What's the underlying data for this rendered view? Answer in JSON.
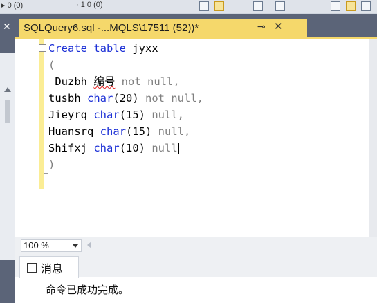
{
  "toolbar": {
    "fragment_left": "▸ 0 (0) ",
    "fragment_mid": "· 1 0 (0)"
  },
  "tab": {
    "title": "SQLQuery6.sql -...MQLS\\17511 (52))*",
    "pin_glyph": "⊸",
    "close_glyph": "✕"
  },
  "editor": {
    "lines": [
      {
        "parts": [
          {
            "t": "Create table ",
            "c": "kw"
          },
          {
            "t": "jyxx",
            "c": ""
          }
        ]
      },
      {
        "parts": [
          {
            "t": "(",
            "c": "gray"
          }
        ]
      },
      {
        "parts": [
          {
            "t": " Duzbh ",
            "c": ""
          },
          {
            "t": "编号",
            "c": "squiggle"
          },
          {
            "t": " not null,",
            "c": "gray"
          }
        ]
      },
      {
        "parts": [
          {
            "t": "tusbh ",
            "c": ""
          },
          {
            "t": "char",
            "c": "kw"
          },
          {
            "t": "(20) ",
            "c": ""
          },
          {
            "t": "not null,",
            "c": "gray"
          }
        ]
      },
      {
        "parts": [
          {
            "t": "Jieyrq ",
            "c": ""
          },
          {
            "t": "char",
            "c": "kw"
          },
          {
            "t": "(15) ",
            "c": ""
          },
          {
            "t": "null,",
            "c": "gray"
          }
        ]
      },
      {
        "parts": [
          {
            "t": "Huansrq ",
            "c": ""
          },
          {
            "t": "char",
            "c": "kw"
          },
          {
            "t": "(15) ",
            "c": ""
          },
          {
            "t": "null,",
            "c": "gray"
          }
        ]
      },
      {
        "parts": [
          {
            "t": "Shifxj ",
            "c": ""
          },
          {
            "t": "char",
            "c": "kw"
          },
          {
            "t": "(10) ",
            "c": ""
          },
          {
            "t": "null",
            "c": "gray"
          }
        ],
        "caret": true
      },
      {
        "parts": [
          {
            "t": ")",
            "c": "gray"
          }
        ]
      }
    ]
  },
  "zoom": {
    "value": "100 %"
  },
  "results": {
    "tab_label": "消息",
    "message": "命令已成功完成。"
  }
}
